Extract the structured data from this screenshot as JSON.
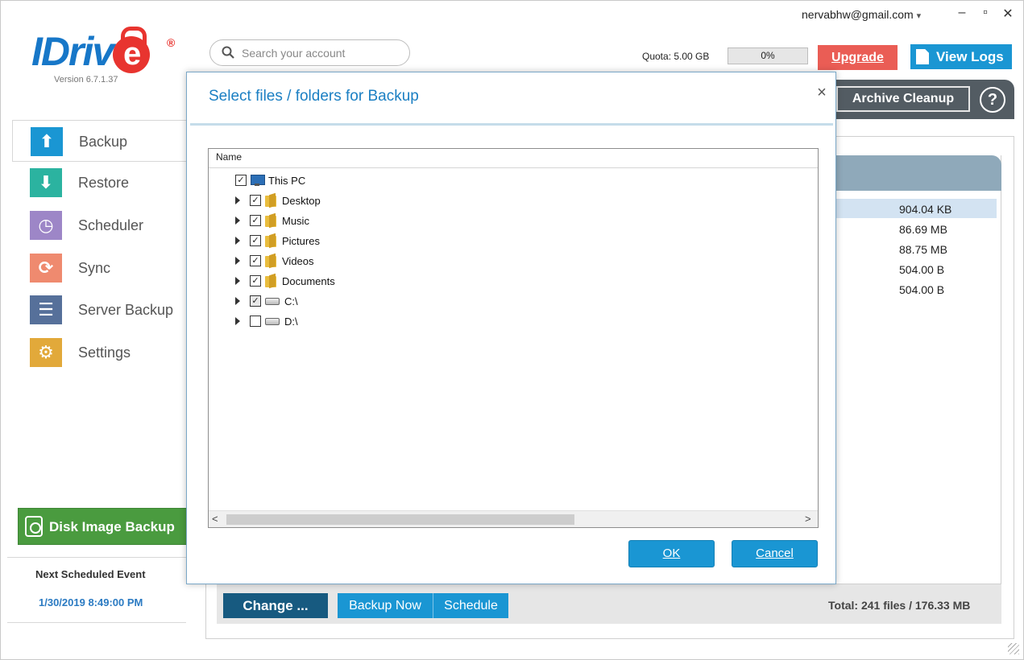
{
  "app": {
    "logo_text": "IDriv",
    "logo_e": "e",
    "logo_reg": "®",
    "version": "Version 6.7.1.37"
  },
  "header": {
    "search_placeholder": "Search your account",
    "user_email": "nervabhw@gmail.com",
    "user_caret": "▾",
    "minimize": "–",
    "maximize": "▫",
    "close": "✕",
    "quota_label": "Quota: 5.00 GB",
    "quota_percent": "0%",
    "quota_fraction": 0.0,
    "upgrade_label": "Upgrade",
    "view_logs_label": "View Logs",
    "archive_cleanup_label": "Archive Cleanup",
    "help_label": "?"
  },
  "sidebar": {
    "items": [
      {
        "label": "Backup",
        "icon": "arrow-up-icon",
        "color": "#1a96d3",
        "glyph": "⬆",
        "active": true
      },
      {
        "label": "Restore",
        "icon": "arrow-down-icon",
        "color": "#2bb3a0",
        "glyph": "⬇",
        "active": false
      },
      {
        "label": "Scheduler",
        "icon": "clock-icon",
        "color": "#9d86c7",
        "glyph": "◷",
        "active": false
      },
      {
        "label": "Sync",
        "icon": "sync-icon",
        "color": "#ef8a6f",
        "glyph": "⟳",
        "active": false
      },
      {
        "label": "Server Backup",
        "icon": "server-icon",
        "color": "#56709a",
        "glyph": "☰",
        "active": false
      },
      {
        "label": "Settings",
        "icon": "gear-icon",
        "color": "#e2a93a",
        "glyph": "⚙",
        "active": false
      }
    ],
    "disk_image_label": "Disk Image Backup",
    "next_scheduled_label": "Next Scheduled Event",
    "next_scheduled_date": "1/30/2019 8:49:00 PM"
  },
  "content": {
    "sizes": [
      "904.04 KB",
      "86.69 MB",
      "88.75 MB",
      "504.00 B",
      "504.00 B"
    ],
    "change_label": "Change ...",
    "backup_now_label": "Backup Now",
    "schedule_label": "Schedule",
    "total_label": "Total: 241 files / 176.33 MB"
  },
  "dialog": {
    "title": "Select files / folders for Backup",
    "close": "×",
    "column_name": "Name",
    "tree": [
      {
        "label": "This PC",
        "type": "pc",
        "checked": true,
        "expandable": false,
        "level": 0
      },
      {
        "label": "Desktop",
        "type": "folder",
        "checked": true,
        "expandable": true,
        "level": 1
      },
      {
        "label": "Music",
        "type": "folder",
        "checked": true,
        "expandable": true,
        "level": 1
      },
      {
        "label": "Pictures",
        "type": "folder",
        "checked": true,
        "expandable": true,
        "level": 1
      },
      {
        "label": "Videos",
        "type": "folder",
        "checked": true,
        "expandable": true,
        "level": 1
      },
      {
        "label": "Documents",
        "type": "folder",
        "checked": true,
        "expandable": true,
        "level": 1
      },
      {
        "label": "C:\\",
        "type": "drive",
        "checked": true,
        "expandable": true,
        "level": 1
      },
      {
        "label": "D:\\",
        "type": "drive",
        "checked": false,
        "expandable": true,
        "level": 1
      }
    ],
    "scroll_left": "<",
    "scroll_right": ">",
    "ok_label": "OK",
    "cancel_label": "Cancel"
  },
  "colors": {
    "brand_blue": "#1a96d3",
    "brand_red": "#e8342f",
    "upgrade_red": "#ea5d55",
    "disk_image_green": "#4a9b3f",
    "toolbar_dark": "#535c63"
  }
}
